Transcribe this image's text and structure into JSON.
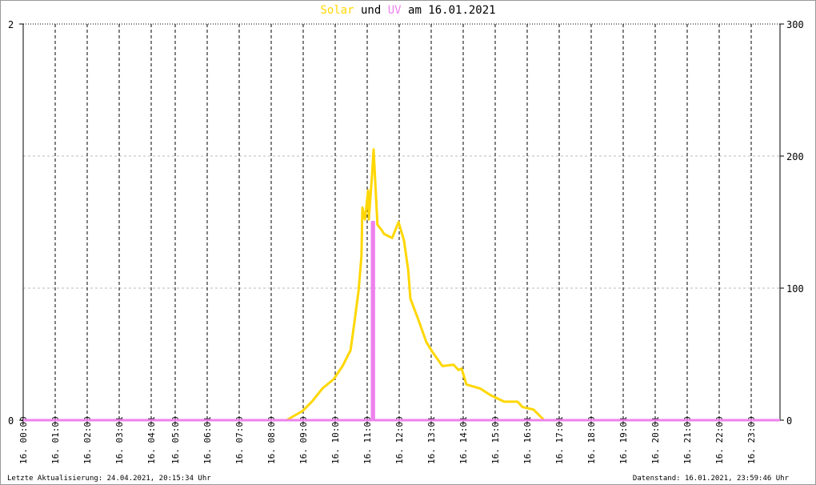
{
  "title": {
    "part1": "Solar",
    "part2": "und",
    "part3": "UV",
    "part4": "am 16.01.2021"
  },
  "footer": {
    "left": "Letzte Aktualisierung: 24.04.2021, 20:15:34 Uhr",
    "right": "Datenstand: 16.01.2021, 23:59:46 Uhr"
  },
  "colors": {
    "solar": "#FFD700",
    "uv": "#EE82EE",
    "axis": "#000000",
    "grid": "#BBBBBB"
  },
  "chart_data": {
    "type": "line",
    "title": "Solar und UV am 16.01.2021",
    "x_unit": "hours",
    "xlim": [
      0,
      23.65
    ],
    "x_ticks": [
      {
        "x": 0,
        "label": "16. 00:00"
      },
      {
        "x": 1,
        "label": "16. 01:00"
      },
      {
        "x": 2,
        "label": "16. 02:00"
      },
      {
        "x": 3,
        "label": "16. 03:01"
      },
      {
        "x": 4,
        "label": "16. 04:01"
      },
      {
        "x": 4.75,
        "label": "16. 05:00"
      },
      {
        "x": 5.75,
        "label": "16. 06:01"
      },
      {
        "x": 6.75,
        "label": "16. 07:00"
      },
      {
        "x": 7.75,
        "label": "16. 08:00"
      },
      {
        "x": 8.75,
        "label": "16. 09:00"
      },
      {
        "x": 9.75,
        "label": "16. 10:00"
      },
      {
        "x": 10.75,
        "label": "16. 11:00"
      },
      {
        "x": 11.75,
        "label": "16. 12:00"
      },
      {
        "x": 12.75,
        "label": "16. 13:01"
      },
      {
        "x": 13.75,
        "label": "16. 14:01"
      },
      {
        "x": 14.75,
        "label": "16. 15:00"
      },
      {
        "x": 15.75,
        "label": "16. 16:01"
      },
      {
        "x": 16.75,
        "label": "16. 17:01"
      },
      {
        "x": 17.75,
        "label": "16. 18:00"
      },
      {
        "x": 18.75,
        "label": "16. 19:01"
      },
      {
        "x": 19.75,
        "label": "16. 20:01"
      },
      {
        "x": 20.75,
        "label": "16. 21:00"
      },
      {
        "x": 21.75,
        "label": "16. 22:00"
      },
      {
        "x": 22.75,
        "label": "16. 23:00"
      }
    ],
    "y_left": {
      "ylim": [
        0,
        2
      ],
      "ticks": [
        "0",
        "2"
      ],
      "series": "UV"
    },
    "y_right": {
      "ylim": [
        0,
        300
      ],
      "ticks": [
        "0",
        "100",
        "200",
        "300"
      ],
      "series": "Solar"
    },
    "grid": true,
    "series": [
      {
        "name": "Solar",
        "axis": "right",
        "x": [
          0,
          8.23,
          8.73,
          9.02,
          9.35,
          9.7,
          9.98,
          10.23,
          10.35,
          10.48,
          10.57,
          10.6,
          10.68,
          10.78,
          10.8,
          10.9,
          10.95,
          11.03,
          11.07,
          11.2,
          11.28,
          11.53,
          11.73,
          11.9,
          12.03,
          12.1,
          12.35,
          12.6,
          12.78,
          13.1,
          13.45,
          13.6,
          13.7,
          13.85,
          14.28,
          14.6,
          15.03,
          15.45,
          15.6,
          15.95,
          16.28,
          23.65
        ],
        "y": [
          0,
          0,
          7,
          14,
          24,
          31,
          41,
          53,
          74,
          98,
          124,
          161,
          152,
          174,
          152,
          185,
          205,
          167,
          148,
          144,
          141,
          138,
          150,
          136,
          114,
          92,
          76,
          59,
          52,
          41,
          42,
          38,
          39,
          27,
          24,
          19,
          14,
          14,
          10,
          8,
          0,
          0
        ]
      },
      {
        "name": "UV",
        "axis": "left",
        "x": [
          0,
          10.9,
          10.9,
          10.93,
          10.96,
          10.96,
          23.65
        ],
        "y": [
          0,
          0,
          1.0,
          1.0,
          1.0,
          0,
          0
        ]
      }
    ]
  }
}
